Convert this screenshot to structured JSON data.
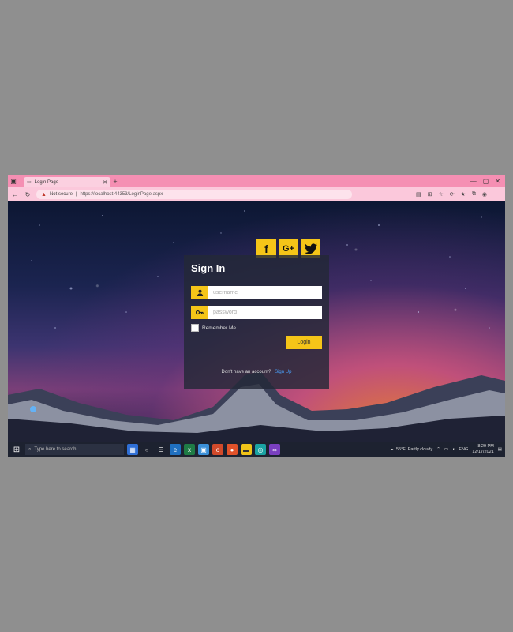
{
  "browser": {
    "tab_title": "Login Page",
    "new_tab": "+",
    "security_label": "Not secure",
    "url": "https://localhost:44353/LoginPage.aspx"
  },
  "social": {
    "facebook": "f",
    "googleplus": "G+",
    "twitter_icon": "twitter-icon"
  },
  "login": {
    "title": "Sign In",
    "username_placeholder": "username",
    "password_placeholder": "password",
    "remember_label": "Remember Me",
    "login_button": "Login",
    "no_account_text": "Don't have an account?",
    "signup_link": "Sign Up"
  },
  "taskbar": {
    "search_placeholder": "Type here to search",
    "temperature": "55°F",
    "weather_text": "Partly cloudy",
    "language": "ENG",
    "time": "8:29 PM",
    "date": "12/17/2021"
  },
  "colors": {
    "accent": "#f5c518",
    "browser_chrome": "#f58fb3",
    "link": "#4aa3ff"
  }
}
